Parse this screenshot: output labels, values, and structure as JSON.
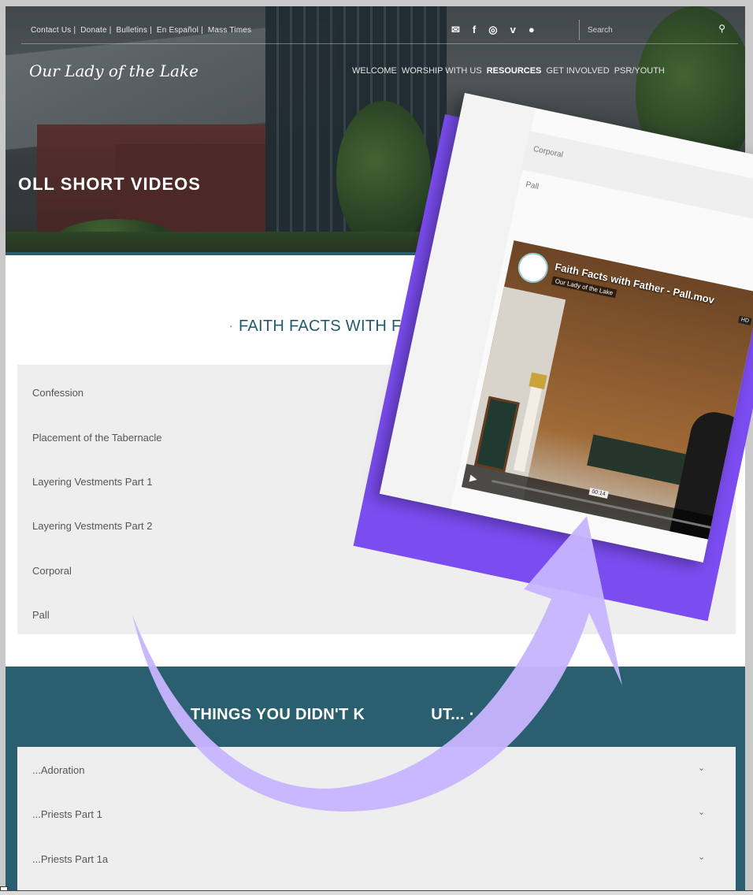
{
  "header": {
    "top_links": [
      "Contact Us",
      "Donate",
      "Bulletins",
      "En Español",
      "Mass Times"
    ],
    "separator": "|",
    "social_icons": [
      "mail-icon",
      "facebook-icon",
      "instagram-icon",
      "vimeo-icon",
      "chat-icon"
    ],
    "social_glyphs": {
      "mail": "✉",
      "facebook": "f",
      "instagram": "◎",
      "vimeo": "v",
      "chat": "●"
    },
    "search_placeholder": "Search",
    "logo": "Our Lady of the Lake",
    "nav": [
      "WELCOME",
      "WORSHIP WITH US",
      "RESOURCES",
      "GET INVOLVED",
      "PSR/YOUTH"
    ],
    "nav_active": "RESOURCES"
  },
  "hero": {
    "title": "OLL SHORT VIDEOS"
  },
  "section1": {
    "title": "FAITH FACTS WITH F",
    "dot": "·",
    "items": [
      "Confession",
      "Placement of the Tabernacle",
      "Layering Vestments Part 1",
      "Layering Vestments Part 2",
      "Corporal",
      "Pall"
    ]
  },
  "section2": {
    "title": "THINGS YOU DIDN'T K",
    "title_tail": "UT... ·",
    "items": [
      "...Adoration",
      "...Priests Part 1",
      "...Priests Part 1a"
    ]
  },
  "overlay": {
    "list_items": [
      "Corporal",
      "Pall"
    ],
    "video_title": "Faith Facts with Father - Pall.mov",
    "channel": "Our Lady of the Lake",
    "hd": "HD",
    "time": "00:14",
    "play_glyph": "▶"
  },
  "glyphs": {
    "chevron": "⌄",
    "search": "⚲"
  },
  "colors": {
    "teal": "#2a5f70",
    "title_teal": "#1f5b6c",
    "purple": "#7b4cf0",
    "arrow": "#c7b4ff"
  }
}
